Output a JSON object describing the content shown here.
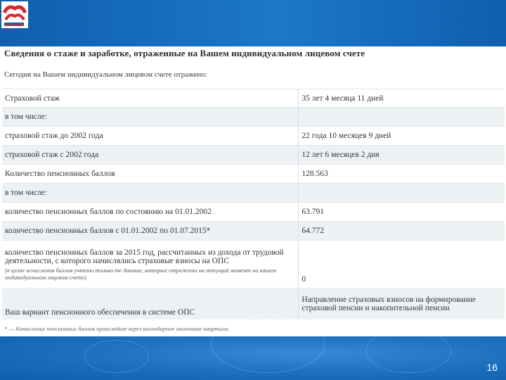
{
  "header": {
    "title": "Сведения о стаже и заработке, отраженные на Вашем индивидуальном лицевом счете",
    "subtitle": "Сегодня на Вашем индивидуальном лицевом счете отражено:"
  },
  "rows": [
    {
      "label": "Страховой стаж",
      "value": "35 лет 4 месяца 11 дней"
    },
    {
      "label": "в том числе:",
      "value": ""
    },
    {
      "label": "страховой стаж до 2002 года",
      "value": "22 года 10 месяцев 9 дней"
    },
    {
      "label": "страховой стаж с 2002 года",
      "value": "12 лет 6 месяцев 2 дня"
    },
    {
      "label": "Количество пенсионных баллов",
      "value": "128.563"
    },
    {
      "label": "в том числе:",
      "value": ""
    },
    {
      "label": "количество пенсионных баллов по состоянию на 01.01.2002",
      "value": "63.791"
    },
    {
      "label": "количество пенсионных баллов с 01.01.2002 по 01.07.2015*",
      "value": "64.772"
    },
    {
      "label": "количество пенсионных баллов за 2015 год, рассчитанных из дохода от трудовой деятельности, с которого начислялись страховые взносы на ОПС",
      "note": "(в целях исчисления баллов учтены только те данные, которые отражены на текущий момент на вашем индивидуальном лицевом счете)",
      "value": "0"
    },
    {
      "label": "Ваш вариант пенсионного обеспечения в системе ОПС",
      "value": "Направление страховых взносов на формирование страховой пенсии и накопительной пенсии"
    }
  ],
  "footnote": "* — Начисление пенсионных баллов происходит через календарное окончание квартала.",
  "page_number": "16",
  "colors": {
    "band": "#1d73c0",
    "row_alt": "#eef1f4"
  }
}
